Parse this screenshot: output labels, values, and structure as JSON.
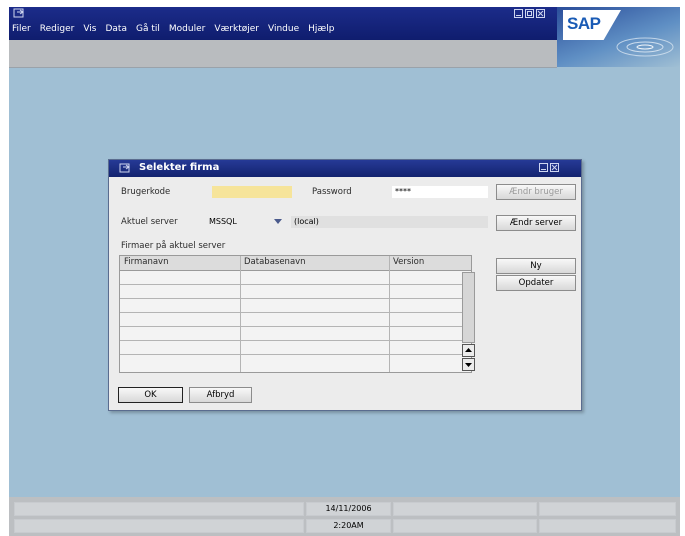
{
  "menu": [
    "Filer",
    "Rediger",
    "Vis",
    "Data",
    "Gå til",
    "Moduler",
    "Værktøjer",
    "Vindue",
    "Hjælp"
  ],
  "brand": {
    "logo_text": "SAP"
  },
  "dialog": {
    "title": "Selekter firma",
    "user_label": "Brugerkode",
    "user_value": "",
    "password_label": "Password",
    "password_value": "****",
    "change_user_label": "Ændr bruger",
    "server_label": "Aktuel server",
    "server_value": "MSSQL",
    "server_name": "(local)",
    "change_server_label": "Ændr server",
    "companies_label": "Firmaer på aktuel server",
    "columns": [
      "Firmanavn",
      "Databasenavn",
      "Version"
    ],
    "new_label": "Ny",
    "update_label": "Opdater",
    "ok_label": "OK",
    "cancel_label": "Afbryd"
  },
  "status": {
    "date": "14/11/2006",
    "time": "2:20AM"
  },
  "colors": {
    "desktop": "#a0bfd4",
    "titlebar": "#13236f",
    "user_field": "#f6e49a"
  }
}
